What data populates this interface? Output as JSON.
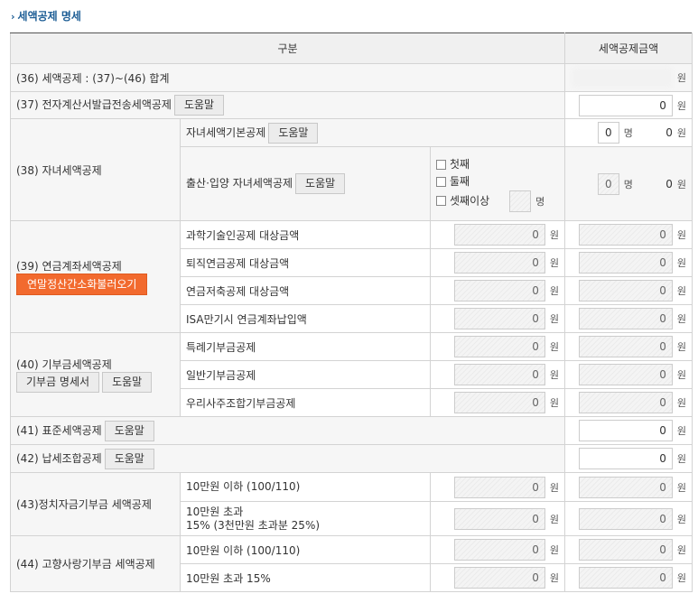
{
  "section": {
    "title": "세액공제 명세"
  },
  "header": {
    "col_category": "구분",
    "col_amount": "세액공제금액"
  },
  "units": {
    "won": "원",
    "people": "명"
  },
  "buttons": {
    "help": "도움말",
    "yearend_import": "연말정산간소화불러오기",
    "donation_detail": "기부금 명세서"
  },
  "rows": {
    "total": {
      "label": "(36) 세액공제 : (37)~(46) 합계"
    },
    "einvoice": {
      "label": "(37) 전자계산서발급전송세액공제",
      "amount": "0"
    },
    "child": {
      "label": "(38) 자녀세액공제",
      "basic": {
        "label": "자녀세액기본공제",
        "count": "0",
        "amount": "0"
      },
      "birth": {
        "label": "출산·입양 자녀세액공제",
        "options": [
          "첫째",
          "둘째",
          "셋째이상"
        ],
        "count": "0",
        "amount": "0"
      }
    },
    "pension": {
      "label": "(39) 연금계좌세액공제",
      "items": [
        {
          "label": "과학기술인공제 대상금액",
          "base": "0",
          "amount": "0"
        },
        {
          "label": "퇴직연금공제 대상금액",
          "base": "0",
          "amount": "0"
        },
        {
          "label": "연금저축공제 대상금액",
          "base": "0",
          "amount": "0"
        },
        {
          "label": "ISA만기시 연금계좌납입액",
          "base": "0",
          "amount": "0"
        }
      ]
    },
    "donation": {
      "label": "(40) 기부금세액공제",
      "items": [
        {
          "label": "특례기부금공제",
          "base": "0",
          "amount": "0"
        },
        {
          "label": "일반기부금공제",
          "base": "0",
          "amount": "0"
        },
        {
          "label": "우리사주조합기부금공제",
          "base": "0",
          "amount": "0"
        }
      ]
    },
    "standard": {
      "label": "(41) 표준세액공제",
      "amount": "0"
    },
    "tax_union": {
      "label": "(42) 납세조합공제",
      "amount": "0"
    },
    "political": {
      "label": "(43)정치자금기부금 세액공제",
      "items": [
        {
          "line1": "10만원 이하 (100/110)",
          "line2": "",
          "base": "0",
          "amount": "0"
        },
        {
          "line1": "10만원 초과",
          "line2": "15% (3천만원 초과분 25%)",
          "base": "0",
          "amount": "0"
        }
      ]
    },
    "hometown": {
      "label": "(44) 고향사랑기부금 세액공제",
      "items": [
        {
          "label": "10만원 이하 (100/110)",
          "base": "0",
          "amount": "0"
        },
        {
          "label": "10만원 초과 15%",
          "base": "0",
          "amount": "0"
        }
      ]
    }
  }
}
